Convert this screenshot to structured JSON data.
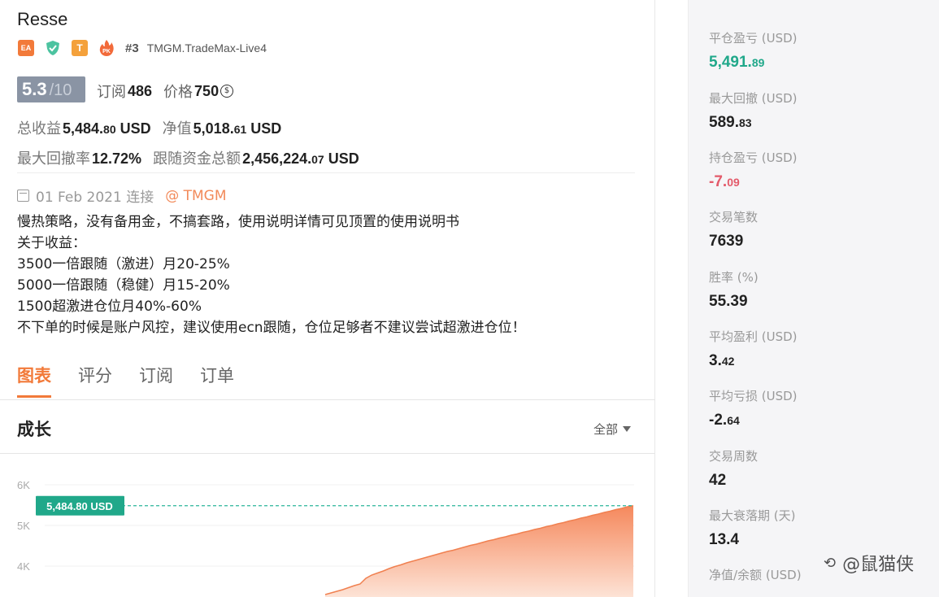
{
  "header": {
    "name": "Resse",
    "badges": {
      "ea": "EA",
      "t": "T",
      "pk": "PK"
    },
    "rank": "#3",
    "server": "TMGM.TradeMax-Live4"
  },
  "rating": {
    "score": "5.3",
    "max": "/10",
    "subscribe_label": "订阅",
    "subscribe_value": "486",
    "price_label": "价格",
    "price_value": "750",
    "coin_symbol": "$"
  },
  "metrics": {
    "total_profit_label": "总收益",
    "total_profit_int": "5,484.",
    "total_profit_dec": "80",
    "total_profit_unit": "USD",
    "equity_label": "净值",
    "equity_int": "5,018.",
    "equity_dec": "61",
    "equity_unit": "USD",
    "max_dd_label": "最大回撤率",
    "max_dd_value": "12.72%",
    "follow_label": "跟随资金总额",
    "follow_int": "2,456,224.",
    "follow_dec": "07",
    "follow_unit": "USD"
  },
  "since": {
    "date_text": "01 Feb 2021 连接",
    "broker": "@ TMGM"
  },
  "description": [
    "慢热策略，没有备用金，不搞套路，使用说明详情可见顶置的使用说明书",
    "关于收益：",
    "3500一倍跟随（激进）月20-25%",
    "5000一倍跟随（稳健）月15-20%",
    "1500超激进仓位月40%-60%",
    "不下单的时候是账户风控，建议使用ecn跟随，仓位足够者不建议尝试超激进仓位！"
  ],
  "tabs": [
    "图表",
    "评分",
    "订阅",
    "订单"
  ],
  "growth": {
    "title": "成长",
    "range": "全部"
  },
  "chart_data": {
    "type": "area",
    "y_ticks": [
      "6K",
      "5K",
      "4K"
    ],
    "current_label": "5,484.80 USD",
    "current_value": 5484.8,
    "ylim": [
      3300,
      6000
    ],
    "values": [
      3300,
      3340,
      3380,
      3420,
      3470,
      3520,
      3560,
      3700,
      3780,
      3830,
      3880,
      3940,
      3990,
      4030,
      4080,
      4120,
      4160,
      4200,
      4240,
      4280,
      4320,
      4360,
      4390,
      4430,
      4470,
      4510,
      4540,
      4580,
      4620,
      4650,
      4690,
      4720,
      4760,
      4790,
      4830,
      4860,
      4900,
      4930,
      4970,
      5000,
      5040,
      5070,
      5110,
      5140,
      5180,
      5210,
      5250,
      5280,
      5320,
      5350,
      5390,
      5420,
      5460,
      5484.8
    ],
    "colors": {
      "fill_top": "#f5885c",
      "fill_bottom": "#fde3d6",
      "line": "#f08050",
      "label_bg": "#20a88a",
      "dash": "#2bb59a"
    }
  },
  "stats": [
    {
      "label": "平仓盈亏 (USD)",
      "int": "5,491.",
      "dec": "89",
      "color": "green"
    },
    {
      "label": "最大回撤 (USD)",
      "int": "589.",
      "dec": "83",
      "color": ""
    },
    {
      "label": "持仓盈亏 (USD)",
      "int": "-7.",
      "dec": "09",
      "color": "red"
    },
    {
      "label": "交易笔数",
      "int": "7639",
      "dec": "",
      "color": ""
    },
    {
      "label": "胜率 (%)",
      "int": "55.39",
      "dec": "",
      "color": ""
    },
    {
      "label": "平均盈利 (USD)",
      "int": "3.",
      "dec": "42",
      "color": ""
    },
    {
      "label": "平均亏损 (USD)",
      "int": "-2.",
      "dec": "64",
      "color": ""
    },
    {
      "label": "交易周数",
      "int": "42",
      "dec": "",
      "color": ""
    },
    {
      "label": "最大衰落期 (天)",
      "int": "13.4",
      "dec": "",
      "color": ""
    },
    {
      "label": "净值/余额 (USD)",
      "int": "",
      "dec": "",
      "color": ""
    }
  ],
  "watermark": {
    "text": "@鼠猫侠"
  }
}
